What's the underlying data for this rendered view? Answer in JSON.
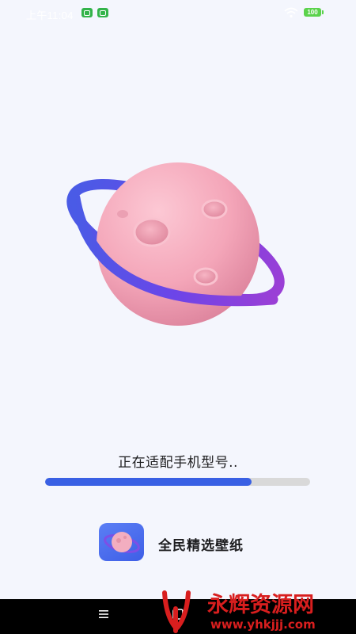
{
  "status_bar": {
    "time": "上午11:04",
    "battery_level": "100",
    "icons": [
      "app-badge-icon",
      "app-badge-icon",
      "wifi-icon",
      "battery-icon"
    ]
  },
  "illustration": {
    "name": "planet-with-ring"
  },
  "loading": {
    "label": "正在适配手机型号..",
    "progress": 0.78
  },
  "app": {
    "name": "全民精选壁纸",
    "icon": "planet-app-icon"
  },
  "nav": {
    "icons": [
      "menu-icon",
      "home-icon"
    ]
  },
  "watermark": {
    "title": "永辉资源网",
    "url": "www.yhkjjj.com"
  },
  "colors": {
    "background": "#f4f6fd",
    "progress_fill": "#3960e4",
    "progress_track": "#d9d9d9",
    "planet": "#f2a3b6",
    "ring": "#6a45e6"
  }
}
